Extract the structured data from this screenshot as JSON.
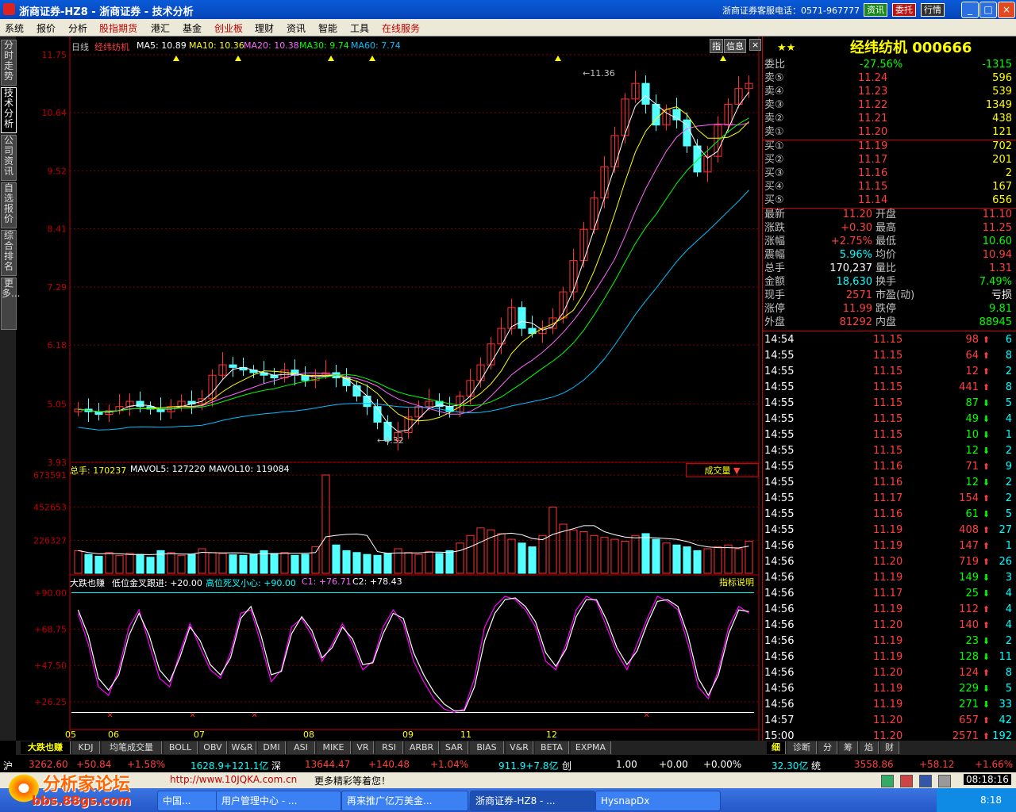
{
  "window": {
    "title": "浙商证券-HZ8 - 浙商证券 - 技术分析",
    "service_phone": "浙商证券客服电话：0571-967777",
    "buttons": [
      "资讯",
      "委托",
      "行情"
    ]
  },
  "menu": [
    "系统",
    "报价",
    "分析",
    "股指期货",
    "港汇",
    "基金",
    "创业板",
    "理财",
    "资讯",
    "智能",
    "工具",
    "在线服务"
  ],
  "left_tabs": [
    "分时走势",
    "技术分析",
    "公司资讯",
    "自选报价",
    "综合排名",
    "更多..."
  ],
  "chart": {
    "period": "日线",
    "stock_name": "经纬纺机",
    "ma_labels": [
      "MA5: 10.89",
      "MA10: 10.36",
      "MA20: 10.38",
      "MA30: 9.74",
      "MA60: 7.74"
    ],
    "buttons": [
      "指",
      "信息"
    ],
    "high_marker": "11.36",
    "low_marker": "4.32",
    "volume_header": [
      "总手: 170237",
      "MAVOL5: 127220",
      "MAVOL10: 119084"
    ],
    "volume_button": "成交量",
    "indicator_header": [
      "大跌也赚",
      "低位金叉跟进: +20.00",
      "高位死叉小心: +90.00",
      "C1: +76.71",
      "C2: +78.43"
    ],
    "indicator_button": "指标说明",
    "month_labels": [
      "05",
      "06",
      "07",
      "08",
      "09",
      "11",
      "12"
    ],
    "indicator_ticks": [
      "+90.00",
      "+68.75",
      "+47.50",
      "+26.25"
    ]
  },
  "chart_data": [
    {
      "type": "candlestick",
      "title": "经纬纺机 日线",
      "ylim": [
        3.93,
        11.75
      ],
      "y_ticks": [
        11.75,
        10.64,
        9.52,
        8.41,
        7.29,
        6.18,
        5.05,
        3.93
      ],
      "series": [
        {
          "name": "MA5",
          "value": 10.89,
          "color": "#ffffff"
        },
        {
          "name": "MA10",
          "value": 10.36,
          "color": "#ffff00"
        },
        {
          "name": "MA20",
          "value": 10.38,
          "color": "#ff66ff"
        },
        {
          "name": "MA30",
          "value": 9.74,
          "color": "#00ff00"
        },
        {
          "name": "MA60",
          "value": 7.74,
          "color": "#00c0ff"
        }
      ],
      "annotations": {
        "high": 11.36,
        "low": 4.32
      },
      "close_path": [
        4.95,
        4.9,
        4.85,
        4.92,
        5.0,
        5.1,
        5.0,
        4.95,
        4.9,
        5.0,
        5.1,
        5.05,
        5.15,
        5.6,
        5.8,
        5.75,
        5.7,
        5.65,
        5.6,
        5.55,
        5.7,
        5.6,
        5.5,
        5.6,
        5.65,
        5.55,
        5.4,
        5.2,
        5.0,
        4.7,
        4.35,
        4.5,
        4.8,
        5.0,
        5.1,
        5.0,
        4.9,
        5.2,
        5.5,
        5.8,
        6.2,
        6.5,
        6.9,
        6.5,
        6.4,
        6.5,
        6.7,
        7.2,
        7.8,
        8.4,
        9.0,
        9.6,
        10.2,
        10.9,
        11.2,
        10.8,
        10.4,
        10.7,
        10.5,
        10.0,
        9.5,
        9.8,
        10.4,
        10.8,
        11.1,
        11.2
      ]
    },
    {
      "type": "bar",
      "title": "成交量",
      "y_ticks": [
        673591,
        452653,
        226327
      ],
      "series": [
        {
          "name": "总手",
          "value": 170237
        },
        {
          "name": "MAVOL5",
          "value": 127220
        },
        {
          "name": "MAVOL10",
          "value": 119084
        }
      ],
      "values": [
        120,
        100,
        90,
        110,
        95,
        105,
        100,
        85,
        120,
        110,
        95,
        100,
        130,
        110,
        105,
        98,
        95,
        100,
        120,
        105,
        110,
        95,
        100,
        140,
        520,
        150,
        120,
        110,
        100,
        95,
        105,
        130,
        110,
        100,
        115,
        105,
        120,
        160,
        200,
        240,
        230,
        210,
        180,
        160,
        140,
        200,
        350,
        260,
        230,
        220,
        200,
        190,
        180,
        170,
        200,
        210,
        180,
        160,
        150,
        140,
        120,
        130,
        140,
        150,
        130,
        170
      ],
      "peak": 673591
    },
    {
      "type": "line",
      "title": "大跌也赚",
      "ylim": [
        10,
        100
      ],
      "y_ticks": [
        90.0,
        68.75,
        47.5,
        26.25
      ],
      "series": [
        {
          "name": "C1",
          "value": 76.71,
          "color": "#ff00ff"
        },
        {
          "name": "C2",
          "value": 78.43,
          "color": "#ffffff"
        },
        {
          "name": "低位金叉跟进",
          "value": 20.0
        },
        {
          "name": "高位死叉小心",
          "value": 90.0
        }
      ],
      "c1_path": [
        78,
        60,
        35,
        30,
        45,
        70,
        80,
        60,
        40,
        35,
        55,
        72,
        58,
        45,
        40,
        55,
        78,
        80,
        60,
        38,
        45,
        70,
        75,
        65,
        50,
        60,
        72,
        60,
        45,
        50,
        70,
        80,
        72,
        50,
        38,
        28,
        22,
        20,
        22,
        40,
        70,
        82,
        88,
        86,
        80,
        70,
        50,
        45,
        60,
        80,
        88,
        85,
        70,
        55,
        45,
        60,
        75,
        88,
        85,
        80,
        60,
        35,
        28,
        45,
        70,
        82,
        78
      ],
      "c2_path": [
        80,
        65,
        40,
        33,
        42,
        65,
        78,
        65,
        45,
        38,
        52,
        70,
        62,
        48,
        42,
        52,
        75,
        82,
        65,
        42,
        44,
        66,
        76,
        68,
        52,
        58,
        70,
        63,
        48,
        49,
        66,
        78,
        75,
        55,
        42,
        32,
        25,
        21,
        21,
        35,
        62,
        78,
        86,
        87,
        82,
        73,
        55,
        47,
        57,
        76,
        86,
        86,
        74,
        58,
        48,
        56,
        72,
        85,
        86,
        82,
        65,
        40,
        30,
        42,
        66,
        80,
        79
      ]
    }
  ],
  "quote": {
    "rating": "★★",
    "title": "经纬纺机 000666",
    "weibi": {
      "label": "委比",
      "ratio": "-27.56%",
      "diff": "-1315"
    },
    "asks": [
      {
        "label": "卖⑤",
        "price": "11.24",
        "vol": "596"
      },
      {
        "label": "卖④",
        "price": "11.23",
        "vol": "539"
      },
      {
        "label": "卖③",
        "price": "11.22",
        "vol": "1349"
      },
      {
        "label": "卖②",
        "price": "11.21",
        "vol": "438"
      },
      {
        "label": "卖①",
        "price": "11.20",
        "vol": "121"
      }
    ],
    "bids": [
      {
        "label": "买①",
        "price": "11.19",
        "vol": "702"
      },
      {
        "label": "买②",
        "price": "11.17",
        "vol": "201"
      },
      {
        "label": "买③",
        "price": "11.16",
        "vol": "2"
      },
      {
        "label": "买④",
        "price": "11.15",
        "vol": "167"
      },
      {
        "label": "买⑤",
        "price": "11.14",
        "vol": "656"
      }
    ],
    "stats": [
      {
        "l1": "最新",
        "v1": "11.20",
        "l2": "开盘",
        "v2": "11.10"
      },
      {
        "l1": "涨跌",
        "v1": "+0.30",
        "l2": "最高",
        "v2": "11.25"
      },
      {
        "l1": "涨幅",
        "v1": "+2.75%",
        "l2": "最低",
        "v2": "10.60"
      },
      {
        "l1": "震幅",
        "v1": "5.96%",
        "l2": "均价",
        "v2": "10.94"
      },
      {
        "l1": "总手",
        "v1": "170,237",
        "l2": "量比",
        "v2": "1.31"
      },
      {
        "l1": "金额",
        "v1": "18,630",
        "l2": "换手",
        "v2": "7.49%"
      },
      {
        "l1": "现手",
        "v1": "2571",
        "l2": "市盈(动)",
        "v2": "亏损"
      },
      {
        "l1": "涨停",
        "v1": "11.99",
        "l2": "跌停",
        "v2": "9.81"
      },
      {
        "l1": "外盘",
        "v1": "81292",
        "l2": "内盘",
        "v2": "88945"
      }
    ],
    "ticks": [
      {
        "t": "14:54",
        "p": "11.15",
        "v": "98",
        "d": "up",
        "n": "6"
      },
      {
        "t": "14:55",
        "p": "11.15",
        "v": "64",
        "d": "up",
        "n": "8"
      },
      {
        "t": "14:55",
        "p": "11.15",
        "v": "12",
        "d": "up",
        "n": "2"
      },
      {
        "t": "14:55",
        "p": "11.15",
        "v": "441",
        "d": "up",
        "n": "8"
      },
      {
        "t": "14:55",
        "p": "11.15",
        "v": "87",
        "d": "down",
        "n": "5"
      },
      {
        "t": "14:55",
        "p": "11.15",
        "v": "49",
        "d": "down",
        "n": "4"
      },
      {
        "t": "14:55",
        "p": "11.15",
        "v": "10",
        "d": "down",
        "n": "1"
      },
      {
        "t": "14:55",
        "p": "11.15",
        "v": "12",
        "d": "down",
        "n": "2"
      },
      {
        "t": "14:55",
        "p": "11.16",
        "v": "71",
        "d": "up",
        "n": "9"
      },
      {
        "t": "14:55",
        "p": "11.16",
        "v": "12",
        "d": "down",
        "n": "2"
      },
      {
        "t": "14:55",
        "p": "11.17",
        "v": "154",
        "d": "up",
        "n": "2"
      },
      {
        "t": "14:55",
        "p": "11.16",
        "v": "61",
        "d": "down",
        "n": "5"
      },
      {
        "t": "14:55",
        "p": "11.19",
        "v": "408",
        "d": "up",
        "n": "27"
      },
      {
        "t": "14:56",
        "p": "11.19",
        "v": "147",
        "d": "up",
        "n": "1"
      },
      {
        "t": "14:56",
        "p": "11.20",
        "v": "719",
        "d": "up",
        "n": "26"
      },
      {
        "t": "14:56",
        "p": "11.19",
        "v": "149",
        "d": "down",
        "n": "3"
      },
      {
        "t": "14:56",
        "p": "11.17",
        "v": "25",
        "d": "down",
        "n": "4"
      },
      {
        "t": "14:56",
        "p": "11.19",
        "v": "112",
        "d": "up",
        "n": "4"
      },
      {
        "t": "14:56",
        "p": "11.20",
        "v": "140",
        "d": "up",
        "n": "4"
      },
      {
        "t": "14:56",
        "p": "11.19",
        "v": "23",
        "d": "down",
        "n": "2"
      },
      {
        "t": "14:56",
        "p": "11.19",
        "v": "128",
        "d": "down",
        "n": "11"
      },
      {
        "t": "14:56",
        "p": "11.20",
        "v": "124",
        "d": "up",
        "n": "8"
      },
      {
        "t": "14:56",
        "p": "11.19",
        "v": "229",
        "d": "down",
        "n": "5"
      },
      {
        "t": "14:56",
        "p": "11.19",
        "v": "271",
        "d": "down",
        "n": "33"
      },
      {
        "t": "14:57",
        "p": "11.20",
        "v": "657",
        "d": "up",
        "n": "42"
      },
      {
        "t": "15:00",
        "p": "11.20",
        "v": "2571",
        "d": "up",
        "n": "192"
      }
    ]
  },
  "bottom_tabs": [
    "大跌也赚",
    "KDJ",
    "均笔成交量",
    "BOLL",
    "OBV",
    "W&R",
    "DMI",
    "ASI",
    "MIKE",
    "VR",
    "RSI",
    "ARBR",
    "SAR",
    "BIAS",
    "V&R",
    "BETA",
    "EXPMA"
  ],
  "right_tabs": [
    "细",
    "诊断",
    "分",
    "筹",
    "焰",
    "财"
  ],
  "status": [
    {
      "text": "沪",
      "color": "#ffffff"
    },
    {
      "text": "3262.60",
      "color": "#ff4040"
    },
    {
      "text": "+50.84",
      "color": "#ff4040"
    },
    {
      "text": "+1.58%",
      "color": "#ff4040"
    },
    {
      "text": "1628.9+121.1亿",
      "color": "#00ffff"
    },
    {
      "text": "深",
      "color": "#ffffff"
    },
    {
      "text": "13644.47",
      "color": "#ff4040"
    },
    {
      "text": "+140.48",
      "color": "#ff4040"
    },
    {
      "text": "+1.04%",
      "color": "#ff4040"
    },
    {
      "text": "911.9+7.8亿",
      "color": "#00ffff"
    },
    {
      "text": "创",
      "color": "#ffffff"
    },
    {
      "text": "1.00",
      "color": "#ffffff"
    },
    {
      "text": "+0.00",
      "color": "#ffffff"
    },
    {
      "text": "+0.00%",
      "color": "#ffffff"
    },
    {
      "text": "32.30亿",
      "color": "#00ffff"
    },
    {
      "text": "统",
      "color": "#ffffff"
    },
    {
      "text": "3558.86",
      "color": "#ff4040"
    },
    {
      "text": "+58.12",
      "color": "#ff4040"
    },
    {
      "text": "+1.66%",
      "color": "#ff4040"
    }
  ],
  "infobar": {
    "site": "http://www.10JQKA.com.cn",
    "msg": "更多精彩等着您！",
    "clock": "08:18:16"
  },
  "watermark": {
    "text": "分析家论坛",
    "url": "bbs.88gs.com"
  },
  "taskbar": {
    "items": [
      "中国...",
      "用户管理中心 - ...",
      "再来推广亿万美金...",
      "浙商证券-HZ8 - ...",
      "HysnapDx"
    ],
    "time": "8:18"
  }
}
